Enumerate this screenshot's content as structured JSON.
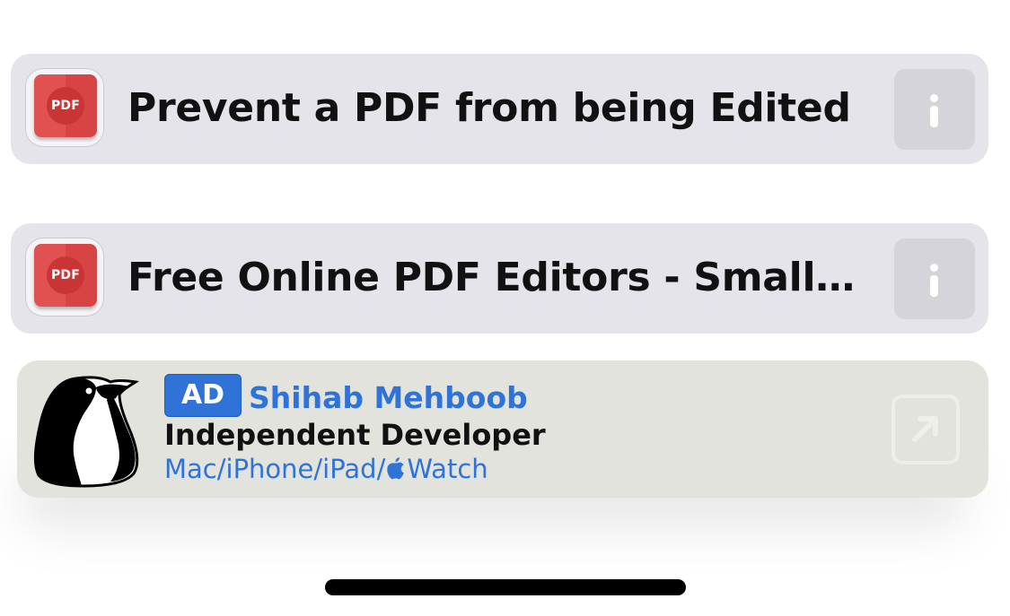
{
  "results": [
    {
      "title": "Prevent a PDF from being Edited",
      "icon": "pdf-app-icon",
      "icon_label": "PDF"
    },
    {
      "title": "Free Online PDF Editors - Small…",
      "icon": "pdf-app-icon",
      "icon_label": "PDF"
    }
  ],
  "ad": {
    "label": "AD",
    "name": "Shihab Mehboob",
    "subtitle": "Independent Developer",
    "platforms_before": "Mac/iPhone/iPad/",
    "platforms_after": "Watch",
    "icon": "penguin-icon"
  },
  "colors": {
    "card_bg": "#e4e4ea",
    "pdf_red": "#e05252",
    "ad_blue": "#2f73d9",
    "ad_card_bg": "#e2e3dc"
  }
}
